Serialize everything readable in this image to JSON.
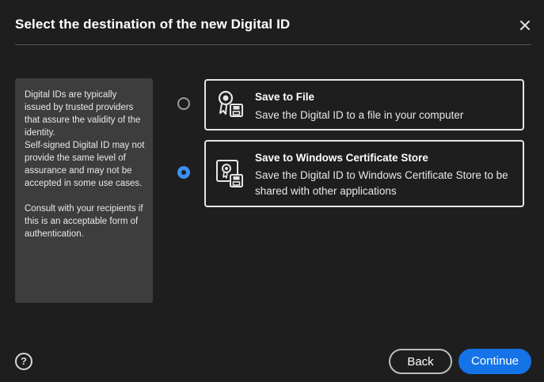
{
  "dialog": {
    "title": "Select the destination of the new Digital ID",
    "close_icon": "close-icon"
  },
  "info": {
    "paragraph1": "Digital IDs are typically issued by trusted providers that assure the validity of the identity.",
    "paragraph2": "Self-signed Digital ID may not provide the same level of assurance and may not be accepted in some use cases.",
    "paragraph3": "Consult with your recipients if this is an acceptable form of authentication."
  },
  "options": [
    {
      "title": "Save to File",
      "description": "Save the Digital ID to a file in your computer",
      "selected": false,
      "icon": "certificate-save-to-file-icon"
    },
    {
      "title": "Save to Windows Certificate Store",
      "description": "Save the Digital ID to Windows Certificate Store to be shared with other applications",
      "selected": true,
      "icon": "certificate-store-icon"
    }
  ],
  "footer": {
    "help_label": "?",
    "back_label": "Back",
    "continue_label": "Continue"
  },
  "colors": {
    "background": "#1e1e1e",
    "panel": "#3d3d3d",
    "accent": "#1473e6",
    "radio_selected": "#3b8ff2"
  }
}
